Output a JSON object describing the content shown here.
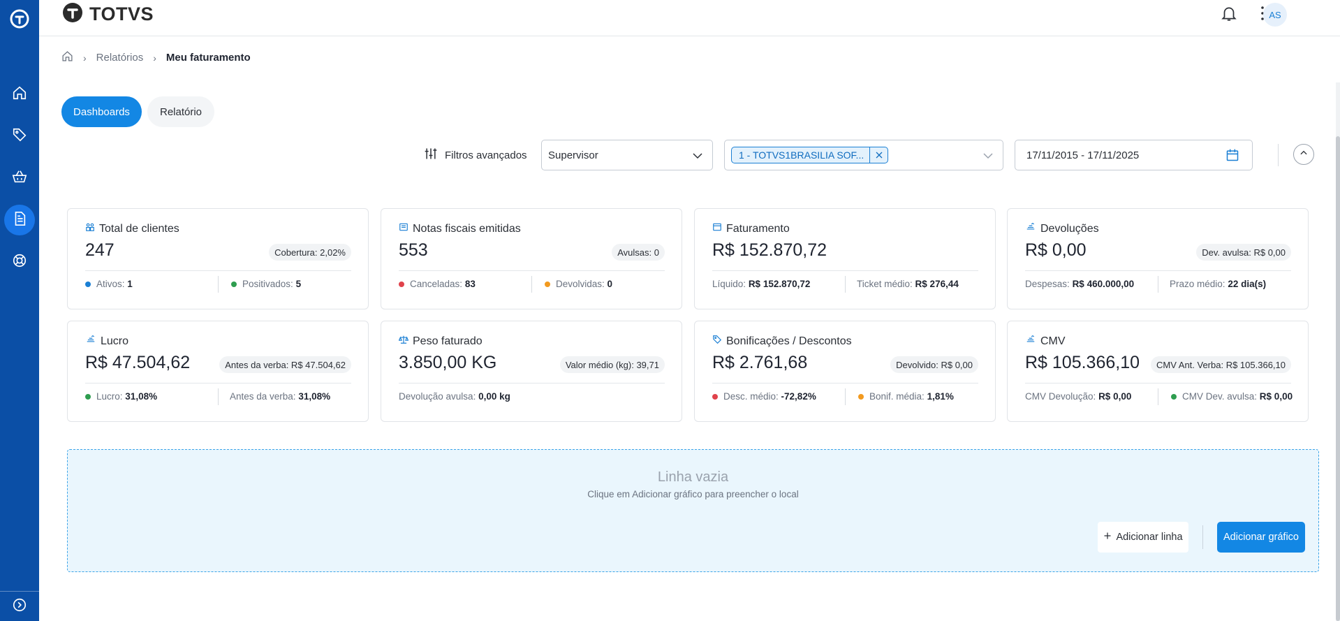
{
  "header": {
    "brand": "TOTVS",
    "avatar_initials": "AS",
    "icons": [
      "notification-bell-icon",
      "apps-grid-icon"
    ]
  },
  "sidebar": {
    "items": [
      "home-icon",
      "tag-icon",
      "basket-icon",
      "reports-icon",
      "support-icon"
    ],
    "active_index": 3,
    "accent": "#0b4fa6"
  },
  "breadcrumb": {
    "items": [
      "Relatórios"
    ],
    "current": "Meu faturamento"
  },
  "tabs": [
    {
      "label": "Dashboards",
      "active": true
    },
    {
      "label": "Relatório",
      "active": false
    }
  ],
  "filters": {
    "advanced_label": "Filtros avançados",
    "group_select": "Supervisor",
    "selected_chip": "1 - TOTVS1BRASILIA SOF...",
    "date_range": "17/11/2015 - 17/11/2025"
  },
  "cards": [
    {
      "icon": "clients-icon",
      "title": "Total de clientes",
      "value": "247",
      "pill": "Cobertura: 2,02%",
      "foot_left": {
        "label": "Ativos:",
        "value": "1",
        "dot": "#1a7fd4"
      },
      "foot_right": {
        "label": "Positivados:",
        "value": "5",
        "dot": "#2e9d4f"
      }
    },
    {
      "icon": "invoice-icon",
      "title": "Notas fiscais emitidas",
      "value": "553",
      "pill": "Avulsas: 0",
      "foot_left": {
        "label": "Canceladas:",
        "value": "83",
        "dot": "#e0424b"
      },
      "foot_right": {
        "label": "Devolvidas:",
        "value": "0",
        "dot": "#f29a1f"
      }
    },
    {
      "icon": "billing-icon",
      "title": "Faturamento",
      "value": "R$ 152.870,72",
      "pill": "",
      "foot_left": {
        "label": "Líquido:",
        "value": "R$ 152.870,72",
        "dot": ""
      },
      "foot_right": {
        "label": "Ticket médio:",
        "value": "R$ 276,44",
        "dot": ""
      }
    },
    {
      "icon": "returns-icon",
      "title": "Devoluções",
      "value": "R$ 0,00",
      "pill": "Dev. avulsa: R$ 0,00",
      "foot_left": {
        "label": "Despesas:",
        "value": "R$ 460.000,00",
        "dot": ""
      },
      "foot_right": {
        "label": "Prazo médio:",
        "value": "22 dia(s)",
        "dot": ""
      }
    },
    {
      "icon": "profit-icon",
      "title": "Lucro",
      "value": "R$ 47.504,62",
      "pill": "Antes da verba: R$ 47.504,62",
      "foot_left": {
        "label": "Lucro:",
        "value": "31,08%",
        "dot": "#2e9d4f"
      },
      "foot_right": {
        "label": "Antes da verba:",
        "value": "31,08%",
        "dot": ""
      }
    },
    {
      "icon": "scale-icon",
      "title": "Peso faturado",
      "value": "3.850,00 KG",
      "pill": "Valor médio (kg): 39,71",
      "foot_left": {
        "label": "Devolução avulsa:",
        "value": "0,00 kg",
        "dot": ""
      },
      "foot_right": null
    },
    {
      "icon": "discount-tag-icon",
      "title": "Bonificações / Descontos",
      "value": "R$ 2.761,68",
      "pill": "Devolvido: R$ 0,00",
      "foot_left": {
        "label": "Desc. médio:",
        "value": "-72,82%",
        "dot": "#e0424b"
      },
      "foot_right": {
        "label": "Bonif. média:",
        "value": "1,81%",
        "dot": "#f29a1f"
      }
    },
    {
      "icon": "cmv-icon",
      "title": "CMV",
      "value": "R$ 105.366,10",
      "pill": "CMV Ant. Verba: R$ 105.366,10",
      "foot_left": {
        "label": "CMV Devolução:",
        "value": "R$ 0,00",
        "dot": ""
      },
      "foot_right": {
        "label": "CMV Dev. avulsa:",
        "value": "R$ 0,00",
        "dot": "#2e9d4f"
      }
    }
  ],
  "empty_row": {
    "title": "Linha vazia",
    "subtitle": "Clique em Adicionar gráfico para preencher o local",
    "add_row_label": "Adicionar linha",
    "add_chart_label": "Adicionar gráfico"
  },
  "colors": {
    "primary": "#1387e4",
    "sidebar": "#0b4fa6"
  }
}
